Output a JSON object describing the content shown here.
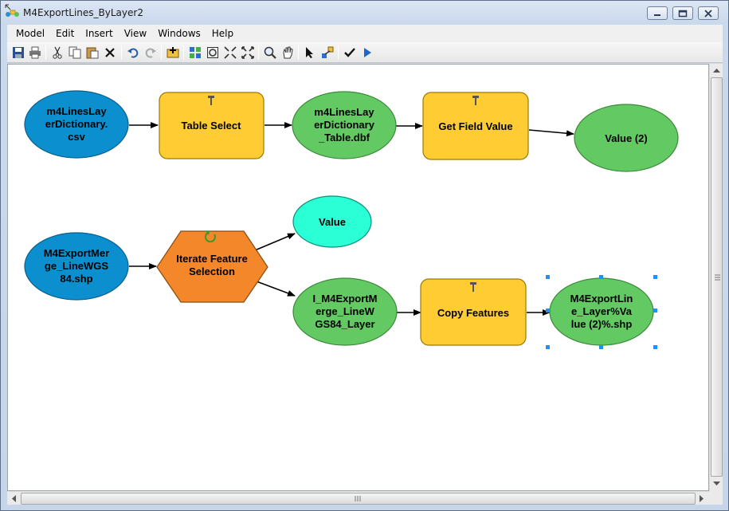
{
  "window": {
    "title": "M4ExportLines_ByLayer2"
  },
  "menu": [
    "Model",
    "Edit",
    "Insert",
    "View",
    "Windows",
    "Help"
  ],
  "toolbar": {
    "icons": [
      "save-icon",
      "print-icon",
      "cut-icon",
      "copy-icon",
      "paste-icon",
      "delete-icon",
      "undo-icon",
      "redo-icon",
      "add-data-icon",
      "auto-layout-icon",
      "full-extent-icon",
      "fixed-zoom-out-icon",
      "zoom-in-fixed-icon",
      "zoom-icon",
      "pan-icon",
      "select-icon",
      "connect-icon",
      "validate-icon",
      "run-icon"
    ]
  },
  "model": {
    "nodes": {
      "input_csv": [
        "m4LinesLay",
        "erDictionary.",
        "csv"
      ],
      "table_select": [
        "Table Select"
      ],
      "table_dbf": [
        "m4LinesLay",
        "erDictionary",
        "_Table.dbf"
      ],
      "get_field_value": [
        "Get Field Value"
      ],
      "value2": [
        "Value (2)"
      ],
      "input_shp": [
        "M4ExportMer",
        "ge_LineWGS",
        "84.shp"
      ],
      "iterate": [
        "Iterate Feature",
        "Selection"
      ],
      "value": [
        "Value"
      ],
      "layer": [
        "I_M4ExportM",
        "erge_LineW",
        "GS84_Layer"
      ],
      "copy_features": [
        "Copy Features"
      ],
      "output_shp": [
        "M4ExportLin",
        "e_Layer%Va",
        "lue (2)%.shp"
      ]
    }
  },
  "colors": {
    "input_blue": "#0c8fce",
    "derived_green": "#63c963",
    "tool_yellow": "#ffcc33",
    "iterator_orange": "#f5872b",
    "value_cyan": "#2bffd6",
    "selection_handle": "#1e90ff"
  }
}
